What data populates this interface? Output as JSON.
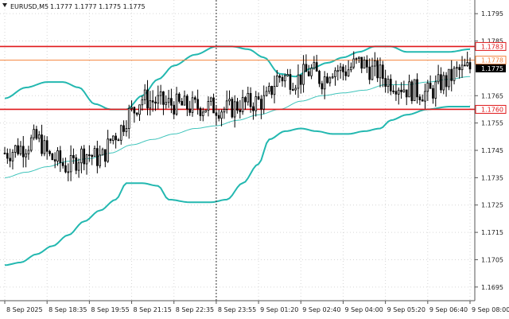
{
  "header": {
    "symbol": "EURUSD,M5",
    "ohlc": "1.1777 1.1777 1.1775 1.1775"
  },
  "chart_data": {
    "type": "candlestick",
    "title": "",
    "ylim": [
      1.169,
      1.18
    ],
    "y_ticks": [
      {
        "v": 1.1795,
        "label": "1.1795"
      },
      {
        "v": 1.1785,
        "label": "1.1785"
      },
      {
        "v": 1.1765,
        "label": "1.1765"
      },
      {
        "v": 1.1755,
        "label": "1.1755"
      },
      {
        "v": 1.1745,
        "label": "1.1745"
      },
      {
        "v": 1.1735,
        "label": "1.1735"
      },
      {
        "v": 1.1725,
        "label": "1.1725"
      },
      {
        "v": 1.1715,
        "label": "1.1715"
      },
      {
        "v": 1.1705,
        "label": "1.1705"
      },
      {
        "v": 1.1695,
        "label": "1.1695"
      }
    ],
    "x_ticks": [
      {
        "i": 0,
        "label": "8 Sep 2025"
      },
      {
        "i": 16,
        "label": "8 Sep 18:35"
      },
      {
        "i": 32,
        "label": "8 Sep 19:55"
      },
      {
        "i": 48,
        "label": "8 Sep 21:15"
      },
      {
        "i": 64,
        "label": "8 Sep 22:35"
      },
      {
        "i": 80,
        "label": "8 Sep 23:55"
      },
      {
        "i": 96,
        "label": "9 Sep 01:20"
      },
      {
        "i": 112,
        "label": "9 Sep 02:40"
      },
      {
        "i": 128,
        "label": "9 Sep 04:00"
      },
      {
        "i": 144,
        "label": "9 Sep 05:20"
      },
      {
        "i": 160,
        "label": "9 Sep 06:40"
      },
      {
        "i": 176,
        "label": "9 Sep 08:00"
      }
    ],
    "levels": [
      {
        "v": 1.1783,
        "label": "1.1783",
        "color": "#e0191b",
        "style": "red"
      },
      {
        "v": 1.1778,
        "label": "1.1778",
        "color": "#f4823c",
        "style": "orange"
      },
      {
        "v": 1.176,
        "label": "1.1760",
        "color": "#e0191b",
        "style": "red"
      }
    ],
    "current_price": {
      "v": 1.1775,
      "label": "1.1775"
    },
    "crosshair_index": 80,
    "anchors": {
      "close": [
        [
          0,
          1.1744
        ],
        [
          6,
          1.1746
        ],
        [
          12,
          1.1749
        ],
        [
          18,
          1.1742
        ],
        [
          24,
          1.1739
        ],
        [
          30,
          1.1744
        ],
        [
          36,
          1.1742
        ],
        [
          42,
          1.1751
        ],
        [
          48,
          1.1759
        ],
        [
          52,
          1.1764
        ],
        [
          56,
          1.1763
        ],
        [
          62,
          1.1762
        ],
        [
          70,
          1.1761
        ],
        [
          78,
          1.1761
        ],
        [
          84,
          1.176
        ],
        [
          90,
          1.1762
        ],
        [
          98,
          1.1763
        ],
        [
          104,
          1.1772
        ],
        [
          110,
          1.1771
        ],
        [
          116,
          1.1774
        ],
        [
          120,
          1.1771
        ],
        [
          124,
          1.1775
        ],
        [
          128,
          1.1774
        ],
        [
          134,
          1.1777
        ],
        [
          140,
          1.1774
        ],
        [
          146,
          1.177
        ],
        [
          154,
          1.1767
        ],
        [
          160,
          1.1766
        ],
        [
          166,
          1.177
        ],
        [
          172,
          1.1774
        ],
        [
          176,
          1.1775
        ]
      ],
      "upper": [
        [
          0,
          1.1764
        ],
        [
          8,
          1.1768
        ],
        [
          16,
          1.177
        ],
        [
          22,
          1.177
        ],
        [
          28,
          1.1768
        ],
        [
          34,
          1.1762
        ],
        [
          40,
          1.176
        ],
        [
          46,
          1.176
        ],
        [
          52,
          1.1765
        ],
        [
          58,
          1.1771
        ],
        [
          64,
          1.1776
        ],
        [
          72,
          1.178
        ],
        [
          80,
          1.1783
        ],
        [
          86,
          1.1783
        ],
        [
          92,
          1.1782
        ],
        [
          98,
          1.1779
        ],
        [
          104,
          1.1773
        ],
        [
          110,
          1.1772
        ],
        [
          116,
          1.1775
        ],
        [
          122,
          1.1777
        ],
        [
          128,
          1.1779
        ],
        [
          134,
          1.1781
        ],
        [
          140,
          1.1783
        ],
        [
          146,
          1.1783
        ],
        [
          152,
          1.1781
        ],
        [
          160,
          1.1781
        ],
        [
          168,
          1.1781
        ],
        [
          176,
          1.1782
        ]
      ],
      "middle": [
        [
          0,
          1.1735
        ],
        [
          8,
          1.1737
        ],
        [
          16,
          1.1739
        ],
        [
          24,
          1.1741
        ],
        [
          32,
          1.1742
        ],
        [
          40,
          1.1744
        ],
        [
          48,
          1.1747
        ],
        [
          56,
          1.1749
        ],
        [
          64,
          1.1751
        ],
        [
          72,
          1.1753
        ],
        [
          80,
          1.1754
        ],
        [
          88,
          1.1756
        ],
        [
          96,
          1.1758
        ],
        [
          104,
          1.176
        ],
        [
          112,
          1.1763
        ],
        [
          120,
          1.1765
        ],
        [
          128,
          1.1766
        ],
        [
          136,
          1.1767
        ],
        [
          144,
          1.1769
        ],
        [
          152,
          1.1769
        ],
        [
          160,
          1.177
        ],
        [
          168,
          1.1771
        ],
        [
          176,
          1.1772
        ]
      ],
      "lower": [
        [
          0,
          1.1703
        ],
        [
          6,
          1.1704
        ],
        [
          12,
          1.1707
        ],
        [
          18,
          1.171
        ],
        [
          24,
          1.1714
        ],
        [
          30,
          1.1719
        ],
        [
          36,
          1.1723
        ],
        [
          42,
          1.1727
        ],
        [
          46,
          1.1733
        ],
        [
          52,
          1.1733
        ],
        [
          58,
          1.1732
        ],
        [
          62,
          1.1727
        ],
        [
          70,
          1.1726
        ],
        [
          78,
          1.1726
        ],
        [
          84,
          1.1727
        ],
        [
          90,
          1.1733
        ],
        [
          96,
          1.174
        ],
        [
          100,
          1.1749
        ],
        [
          106,
          1.1752
        ],
        [
          112,
          1.1753
        ],
        [
          118,
          1.1752
        ],
        [
          124,
          1.1751
        ],
        [
          130,
          1.1751
        ],
        [
          136,
          1.1752
        ],
        [
          142,
          1.1753
        ],
        [
          146,
          1.1756
        ],
        [
          152,
          1.1758
        ],
        [
          160,
          1.176
        ],
        [
          168,
          1.1761
        ],
        [
          176,
          1.1761
        ]
      ]
    },
    "colors": {
      "candle": "#000000",
      "band": "#23b8b0",
      "middle": "#3fc4bb",
      "grid": "#d6d6d6",
      "axis": "#555555",
      "current_tag_bg": "#000000",
      "current_tag_fg": "#ffffff"
    }
  }
}
